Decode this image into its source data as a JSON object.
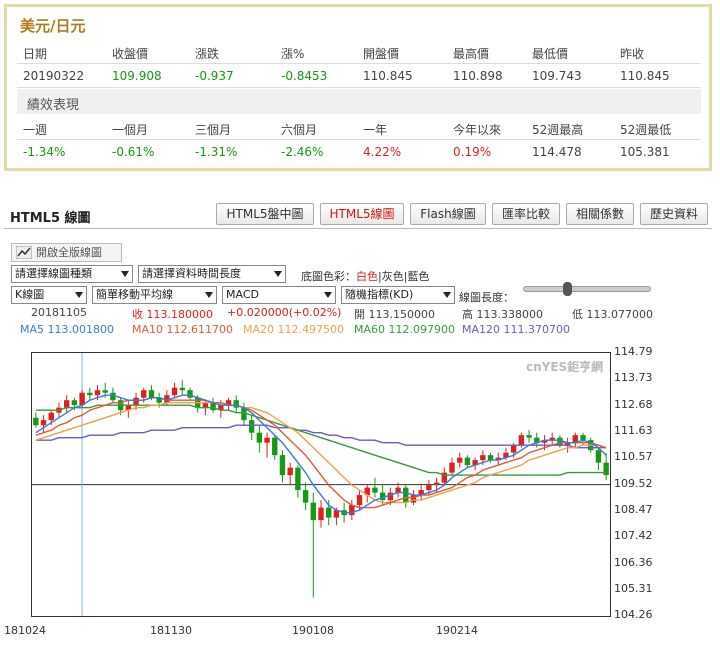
{
  "quote": {
    "title": "美元/日元",
    "headers": [
      "日期",
      "收盤價",
      "漲跌",
      "漲%",
      "開盤價",
      "最高價",
      "最低價",
      "昨收"
    ],
    "values": [
      "20190322",
      "109.908",
      "-0.937",
      "-0.8453",
      "110.845",
      "110.898",
      "109.743",
      "110.845"
    ],
    "perf_title": "績效表現",
    "perf_headers": [
      "一週",
      "一個月",
      "三個月",
      "六個月",
      "一年",
      "今年以來",
      "52週最高",
      "52週最低"
    ],
    "perf_values": [
      "-1.34%",
      "-0.61%",
      "-1.31%",
      "-2.46%",
      "4.22%",
      "0.19%",
      "114.478",
      "105.381"
    ]
  },
  "chart_panel": {
    "title": "HTML5 線圖",
    "tabs": [
      "HTML5盤中圖",
      "HTML5線圖",
      "Flash線圖",
      "匯率比較",
      "相關係數",
      "歷史資料"
    ],
    "active_tab": "HTML5線圖",
    "full_version_label": "開啟全版線圖",
    "select_chart_type": "請選擇線圖種類",
    "select_period": "請選擇資料時間長度",
    "bg_color_label": "底圖色彩：",
    "bg_white": "白色",
    "bg_gray": "灰色",
    "bg_blue": "藍色",
    "bg_sep": "|",
    "sel_kline": "K線圖",
    "sel_ma": "簡單移動平均線",
    "sel_macd": "MACD",
    "sel_kd": "隨機指標(KD)",
    "length_label": "線圖長度：",
    "info": {
      "date": "20181105",
      "close": "收 113.180000",
      "change": "+0.020000(+0.02%)",
      "open": "開 113.150000",
      "high": "高 113.338000",
      "low": "低 113.077000",
      "ma5": "MA5 113.001800",
      "ma10": "MA10 112.611700",
      "ma20": "MA20 112.497500",
      "ma60": "MA60 112.097900",
      "ma120": "MA120 111.370700"
    },
    "watermark": "cnYES鉅亨網"
  },
  "colors": {
    "up": "#e02020",
    "down": "#159a15",
    "ma5": "#3a7bd5",
    "ma10": "#e05a3a",
    "ma20": "#f0a050",
    "ma60": "#3a9a3a",
    "ma120": "#6a5acd",
    "gold": "#b07a1f"
  },
  "chart_data": {
    "type": "candlestick",
    "ylim": [
      104.26,
      114.79
    ],
    "yticks": [
      "114.79",
      "113.73",
      "112.68",
      "111.63",
      "110.57",
      "109.52",
      "108.47",
      "107.42",
      "106.36",
      "105.31",
      "104.26"
    ],
    "xticks": [
      "181024",
      "181130",
      "190108",
      "190214"
    ],
    "hline": 109.52,
    "candles": [
      [
        112.2,
        112.4,
        111.8,
        111.9
      ],
      [
        111.9,
        112.3,
        111.6,
        112.1
      ],
      [
        112.1,
        112.5,
        111.9,
        112.4
      ],
      [
        112.4,
        112.8,
        112.2,
        112.6
      ],
      [
        112.6,
        113.1,
        112.4,
        112.9
      ],
      [
        112.9,
        113.0,
        112.5,
        112.7
      ],
      [
        112.7,
        113.3,
        112.6,
        113.2
      ],
      [
        113.2,
        113.4,
        112.9,
        113.1
      ],
      [
        113.1,
        113.5,
        112.9,
        113.3
      ],
      [
        113.3,
        113.6,
        113.0,
        113.2
      ],
      [
        113.2,
        113.4,
        112.8,
        112.9
      ],
      [
        112.9,
        113.0,
        112.3,
        112.5
      ],
      [
        112.5,
        112.9,
        112.2,
        112.7
      ],
      [
        112.7,
        113.2,
        112.5,
        113.0
      ],
      [
        113.0,
        113.4,
        112.8,
        113.3
      ],
      [
        113.3,
        113.5,
        112.9,
        113.0
      ],
      [
        113.0,
        113.2,
        112.6,
        112.8
      ],
      [
        112.8,
        113.3,
        112.7,
        113.1
      ],
      [
        113.1,
        113.6,
        113.0,
        113.4
      ],
      [
        113.4,
        113.7,
        113.1,
        113.3
      ],
      [
        113.3,
        113.4,
        112.9,
        113.0
      ],
      [
        113.0,
        113.1,
        112.4,
        112.6
      ],
      [
        112.6,
        112.9,
        112.3,
        112.8
      ],
      [
        112.8,
        113.0,
        112.4,
        112.5
      ],
      [
        112.5,
        112.9,
        112.2,
        112.7
      ],
      [
        112.7,
        113.0,
        112.5,
        112.9
      ],
      [
        112.9,
        113.1,
        112.4,
        112.6
      ],
      [
        112.6,
        112.8,
        111.9,
        112.1
      ],
      [
        112.1,
        112.3,
        111.3,
        111.6
      ],
      [
        111.6,
        111.9,
        110.8,
        111.2
      ],
      [
        111.2,
        111.6,
        110.6,
        111.4
      ],
      [
        111.4,
        111.5,
        110.5,
        110.7
      ],
      [
        110.7,
        110.9,
        109.6,
        109.9
      ],
      [
        109.9,
        110.4,
        109.5,
        110.2
      ],
      [
        110.2,
        110.3,
        109.0,
        109.3
      ],
      [
        109.3,
        109.6,
        108.5,
        108.8
      ],
      [
        108.8,
        109.2,
        105.0,
        108.1
      ],
      [
        108.1,
        108.9,
        107.8,
        108.6
      ],
      [
        108.6,
        108.9,
        107.9,
        108.2
      ],
      [
        108.2,
        108.6,
        107.9,
        108.5
      ],
      [
        108.5,
        108.8,
        108.0,
        108.3
      ],
      [
        108.3,
        108.9,
        108.1,
        108.7
      ],
      [
        108.7,
        109.3,
        108.5,
        109.1
      ],
      [
        109.1,
        109.5,
        108.8,
        109.4
      ],
      [
        109.4,
        109.8,
        109.0,
        109.2
      ],
      [
        109.2,
        109.5,
        108.7,
        108.9
      ],
      [
        108.9,
        109.4,
        108.7,
        109.2
      ],
      [
        109.2,
        109.6,
        109.0,
        109.4
      ],
      [
        109.4,
        109.5,
        108.6,
        108.8
      ],
      [
        108.8,
        109.3,
        108.7,
        109.1
      ],
      [
        109.1,
        109.5,
        108.9,
        109.3
      ],
      [
        109.3,
        109.7,
        109.1,
        109.5
      ],
      [
        109.5,
        109.8,
        109.2,
        109.6
      ],
      [
        109.6,
        110.2,
        109.5,
        110.0
      ],
      [
        110.0,
        110.6,
        109.9,
        110.4
      ],
      [
        110.4,
        110.8,
        110.2,
        110.6
      ],
      [
        110.6,
        110.7,
        110.2,
        110.3
      ],
      [
        110.3,
        110.6,
        110.1,
        110.5
      ],
      [
        110.5,
        110.9,
        110.3,
        110.7
      ],
      [
        110.7,
        110.8,
        110.4,
        110.5
      ],
      [
        110.5,
        110.8,
        110.3,
        110.6
      ],
      [
        110.6,
        111.0,
        110.5,
        110.8
      ],
      [
        110.8,
        111.2,
        110.6,
        111.1
      ],
      [
        111.1,
        111.6,
        111.0,
        111.5
      ],
      [
        111.5,
        111.7,
        111.2,
        111.4
      ],
      [
        111.4,
        111.6,
        111.0,
        111.2
      ],
      [
        111.2,
        111.5,
        110.9,
        111.3
      ],
      [
        111.3,
        111.6,
        111.1,
        111.4
      ],
      [
        111.4,
        111.5,
        111.0,
        111.1
      ],
      [
        111.1,
        111.4,
        110.8,
        111.2
      ],
      [
        111.2,
        111.6,
        111.0,
        111.5
      ],
      [
        111.5,
        111.6,
        111.1,
        111.3
      ],
      [
        111.3,
        111.4,
        110.8,
        110.9
      ],
      [
        110.9,
        111.0,
        110.1,
        110.4
      ],
      [
        110.4,
        110.8,
        109.7,
        109.9
      ]
    ],
    "ma5": [
      111.6,
      111.8,
      112.0,
      112.2,
      112.4,
      112.6,
      112.7,
      112.9,
      113.0,
      113.1,
      113.1,
      113.0,
      112.9,
      112.9,
      112.9,
      113.0,
      113.0,
      112.9,
      113.0,
      113.1,
      113.1,
      113.0,
      112.9,
      112.8,
      112.7,
      112.7,
      112.7,
      112.6,
      112.4,
      112.1,
      111.8,
      111.5,
      111.2,
      110.8,
      110.4,
      110.0,
      109.5,
      109.1,
      108.7,
      108.5,
      108.4,
      108.4,
      108.5,
      108.7,
      108.9,
      109.0,
      109.1,
      109.2,
      109.2,
      109.1,
      109.1,
      109.2,
      109.3,
      109.5,
      109.8,
      110.0,
      110.2,
      110.3,
      110.4,
      110.5,
      110.5,
      110.6,
      110.7,
      110.9,
      111.1,
      111.2,
      111.3,
      111.3,
      111.3,
      111.2,
      111.2,
      111.3,
      111.2,
      111.0,
      110.7
    ],
    "ma10": [
      111.5,
      111.6,
      111.7,
      111.9,
      112.0,
      112.2,
      112.3,
      112.5,
      112.6,
      112.7,
      112.8,
      112.8,
      112.9,
      112.9,
      112.9,
      113.0,
      113.0,
      112.9,
      112.9,
      112.9,
      112.9,
      112.9,
      112.9,
      112.8,
      112.8,
      112.7,
      112.7,
      112.6,
      112.5,
      112.3,
      112.1,
      111.9,
      111.6,
      111.3,
      111.0,
      110.7,
      110.3,
      109.9,
      109.5,
      109.2,
      108.9,
      108.7,
      108.6,
      108.6,
      108.6,
      108.7,
      108.8,
      108.9,
      109.0,
      109.0,
      109.1,
      109.1,
      109.2,
      109.3,
      109.4,
      109.6,
      109.8,
      109.9,
      110.1,
      110.2,
      110.3,
      110.4,
      110.5,
      110.6,
      110.8,
      110.9,
      111.0,
      111.1,
      111.2,
      111.2,
      111.2,
      111.2,
      111.2,
      111.1,
      111.0
    ],
    "ma20": [
      111.3,
      111.4,
      111.5,
      111.6,
      111.7,
      111.8,
      111.9,
      112.0,
      112.1,
      112.2,
      112.3,
      112.4,
      112.5,
      112.6,
      112.6,
      112.7,
      112.7,
      112.8,
      112.8,
      112.8,
      112.8,
      112.8,
      112.8,
      112.8,
      112.8,
      112.7,
      112.7,
      112.6,
      112.6,
      112.5,
      112.4,
      112.2,
      112.0,
      111.8,
      111.6,
      111.3,
      111.0,
      110.7,
      110.4,
      110.1,
      109.8,
      109.5,
      109.3,
      109.1,
      108.9,
      108.8,
      108.8,
      108.8,
      108.8,
      108.9,
      108.9,
      109.0,
      109.1,
      109.2,
      109.3,
      109.4,
      109.5,
      109.6,
      109.8,
      109.9,
      110.0,
      110.1,
      110.2,
      110.3,
      110.5,
      110.6,
      110.7,
      110.8,
      110.9,
      111.0,
      111.0,
      111.1,
      111.1,
      111.1,
      111.0
    ],
    "ma60": [
      112.5,
      112.5,
      112.5,
      112.5,
      112.6,
      112.6,
      112.6,
      112.6,
      112.7,
      112.7,
      112.7,
      112.7,
      112.7,
      112.7,
      112.7,
      112.7,
      112.7,
      112.7,
      112.7,
      112.7,
      112.7,
      112.6,
      112.6,
      112.6,
      112.5,
      112.5,
      112.4,
      112.4,
      112.3,
      112.2,
      112.1,
      112.0,
      111.9,
      111.8,
      111.7,
      111.6,
      111.5,
      111.4,
      111.3,
      111.2,
      111.1,
      111.0,
      110.9,
      110.8,
      110.7,
      110.6,
      110.5,
      110.4,
      110.3,
      110.2,
      110.1,
      110.0,
      110.0,
      109.9,
      109.9,
      109.9,
      109.9,
      109.9,
      109.9,
      109.9,
      109.9,
      109.9,
      109.9,
      109.9,
      109.9,
      109.9,
      109.9,
      109.9,
      109.9,
      110.0,
      110.0,
      110.0,
      110.0,
      110.0,
      110.0
    ],
    "ma120": [
      111.3,
      111.3,
      111.3,
      111.4,
      111.4,
      111.4,
      111.4,
      111.5,
      111.5,
      111.5,
      111.5,
      111.6,
      111.6,
      111.6,
      111.6,
      111.7,
      111.7,
      111.7,
      111.7,
      111.8,
      111.8,
      111.8,
      111.8,
      111.8,
      111.8,
      111.8,
      111.9,
      111.9,
      111.9,
      111.9,
      111.9,
      111.8,
      111.8,
      111.8,
      111.7,
      111.7,
      111.6,
      111.6,
      111.5,
      111.5,
      111.4,
      111.4,
      111.3,
      111.3,
      111.3,
      111.2,
      111.2,
      111.2,
      111.1,
      111.1,
      111.1,
      111.1,
      111.1,
      111.1,
      111.1,
      111.1,
      111.1,
      111.1,
      111.1,
      111.1,
      111.1,
      111.1,
      111.1,
      111.1,
      111.1,
      111.1,
      111.1,
      111.1,
      111.1,
      111.1,
      111.0,
      111.0,
      111.0,
      111.0,
      111.0
    ]
  }
}
